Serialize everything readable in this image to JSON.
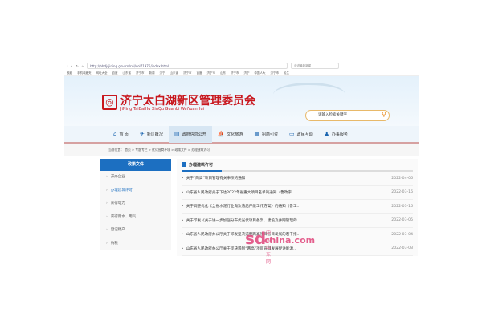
{
  "browser": {
    "url": "http://bhdjsjining.gov.cn/col/col71975/index.html",
    "search": "说说最新新闻",
    "bookmarks": [
      "收藏",
      "手机收藏夹",
      "网址大全",
      "百度",
      "山东省",
      "济宁市",
      "新闻",
      "济宁",
      "山东省",
      "济宁市",
      "百度",
      "济宁市",
      "山东",
      "济宁市",
      "济宁",
      "中国人大",
      "济宁市",
      "民生"
    ]
  },
  "header": {
    "title": "济宁太白湖新区管理委员会",
    "subtitle": "JiNing TaiBaiHu XinQu GuanLi WeiYuanHui",
    "search_placeholder": "请输入检索关键字"
  },
  "nav": [
    {
      "label": "首 页",
      "icon": "home-icon"
    },
    {
      "label": "新区概况",
      "icon": "bird-icon"
    },
    {
      "label": "政府信息公开",
      "icon": "document-icon"
    },
    {
      "label": "文化旅游",
      "icon": "boat-icon"
    },
    {
      "label": "招商引资",
      "icon": "building-icon"
    },
    {
      "label": "政民互动",
      "icon": "chat-icon"
    },
    {
      "label": "办事服务",
      "icon": "person-icon"
    }
  ],
  "breadcrumb": "当前位置： 首页 > 专题专栏 > 优化营商环境 > 政策文件 > 办理建筑许可",
  "sidebar": {
    "title": "政策文件",
    "items": [
      "开办企业",
      "办理建筑许可",
      "获得电力",
      "获得用水、用气",
      "登记财产",
      "纳税"
    ]
  },
  "main": {
    "title": "办理建筑许可",
    "rows": [
      {
        "title": "关于“两高”项目管理有关事项的通知",
        "date": "2022-04-06"
      },
      {
        "title": "山东省人民政府关于下达2022年省重大项目名单的通知（鲁政字...",
        "date": "2022-03-16"
      },
      {
        "title": "关于调整优化《全省水泥行业淘汰落后产能工作方案》的通知（鲁工...",
        "date": "2022-03-16"
      },
      {
        "title": "关于印发《关于进一步加强分布式光伏项目备案、建设及并网管理的...",
        "date": "2022-03-05"
      },
      {
        "title": "山东省人民政府办公厅关于印发坚决遏制两高项目盲目发展的若干措...",
        "date": "2022-03-04"
      },
      {
        "title": "山东省人民政府办公厅关于坚决遏制“两高”项目盲目发展促进能源...",
        "date": "2022-03-03"
      }
    ]
  },
  "watermark": "中国山东网 sdchina.com"
}
